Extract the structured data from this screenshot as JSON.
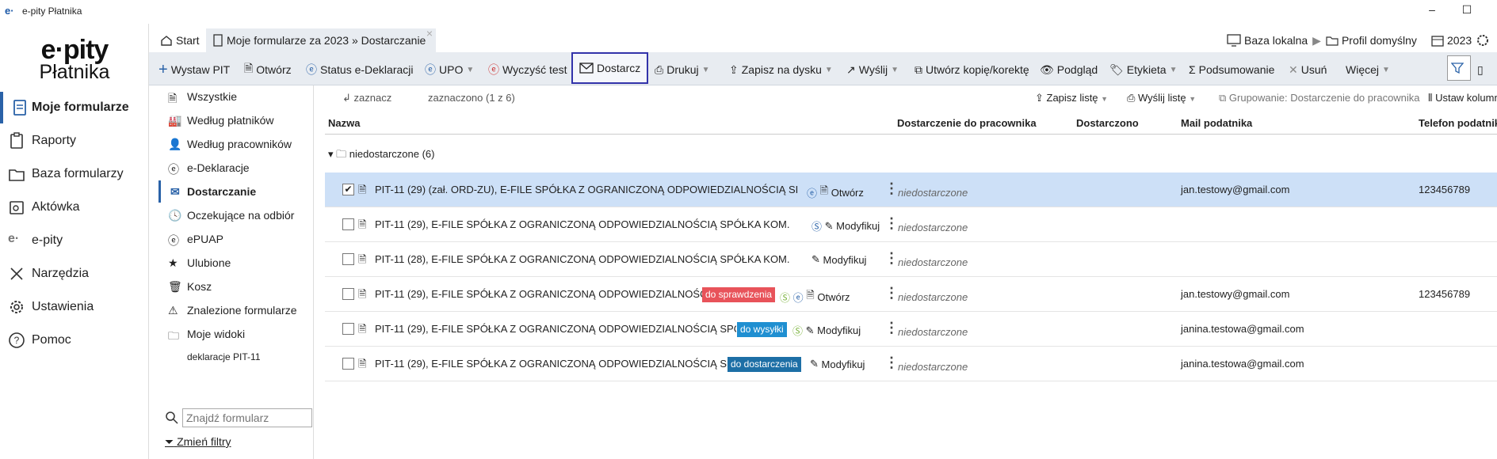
{
  "window": {
    "app_title": "e-pity Płatnika",
    "minimize": "–",
    "maximize": "☐"
  },
  "brand": {
    "logo": "e·pity",
    "subtitle": "Płatnika"
  },
  "nav": {
    "items": [
      {
        "label": "Moje formularze",
        "icon": "document-icon",
        "active": true
      },
      {
        "label": "Raporty",
        "icon": "clipboard-icon"
      },
      {
        "label": "Baza formularzy",
        "icon": "folder-icon"
      },
      {
        "label": "Aktówka",
        "icon": "briefcase-icon"
      },
      {
        "label": "e-pity",
        "icon": "epity-icon"
      },
      {
        "label": "Narzędzia",
        "icon": "tools-icon"
      },
      {
        "label": "Ustawienia",
        "icon": "gear-icon"
      },
      {
        "label": "Pomoc",
        "icon": "help-icon"
      }
    ]
  },
  "tabs": {
    "start": "Start",
    "forms": "Moje formularze za 2023 » Dostarczanie",
    "close": "×"
  },
  "header": {
    "db": "Baza lokalna",
    "profile": "Profil domyślny",
    "year": "2023"
  },
  "toolbar": {
    "wystaw": "Wystaw PIT",
    "otworz": "Otwórz",
    "status": "Status e-Deklaracji",
    "upo": "UPO",
    "wyczysc": "Wyczyść test",
    "dostarcz": "Dostarcz",
    "drukuj": "Drukuj",
    "zapisz": "Zapisz na dysku",
    "wyslij": "Wyślij",
    "kopia": "Utwórz kopię/korektę",
    "podglad": "Podgląd",
    "etykieta": "Etykieta",
    "podsumowanie": "Podsumowanie",
    "usun": "Usuń",
    "wiecej": "Więcej"
  },
  "sidepanel": {
    "items": [
      "Wszystkie",
      "Według płatników",
      "Według pracowników",
      "e-Deklaracje",
      "Dostarczanie",
      "Oczekujące na odbiór",
      "ePUAP",
      "Ulubione",
      "Kosz",
      "Znalezione formularze",
      "Moje widoki"
    ],
    "sub": "deklaracje PIT-11",
    "search_placeholder": "Znajdź formularz",
    "filter_link": "Zmień filtry"
  },
  "subbar": {
    "zaznacz": "zaznacz",
    "zaznaczono": "zaznaczono (1 z 6)",
    "zapisz_liste": "Zapisz listę",
    "wyslij_liste": "Wyślij listę",
    "grupowanie": "Grupowanie: Dostarczenie do pracownika",
    "ustaw": "Ustaw kolumny"
  },
  "columns": {
    "nazwa": "Nazwa",
    "dostarczenie": "Dostarczenie do pracownika",
    "dostarczono": "Dostarczono",
    "mail": "Mail podatnika",
    "telefon": "Telefon podatnika"
  },
  "group": {
    "label": "niedostarczone (6)"
  },
  "rows": [
    {
      "name": "PIT-11 (29) (zał. ORD-ZU), E-FILE SPÓŁKA Z OGRANICZONĄ ODPOWIEDZIALNOŚCIĄ SI",
      "status": "niedostarczone",
      "mail": "jan.testowy@gmail.com",
      "tel": "123456789",
      "action": "Otwórz",
      "badge": "",
      "checked": "✔"
    },
    {
      "name": "PIT-11 (29), E-FILE SPÓŁKA Z OGRANICZONĄ ODPOWIEDZIALNOŚCIĄ SPÓŁKA KOM.",
      "status": "niedostarczone",
      "mail": "",
      "tel": "",
      "action": "Modyfikuj",
      "badge": "",
      "checked": ""
    },
    {
      "name": "PIT-11 (28), E-FILE SPÓŁKA Z OGRANICZONĄ ODPOWIEDZIALNOŚCIĄ SPÓŁKA KOM.",
      "status": "niedostarczone",
      "mail": "",
      "tel": "",
      "action": "Modyfikuj",
      "badge": "",
      "checked": ""
    },
    {
      "name": "PIT-11 (29), E-FILE SPÓŁKA Z OGRANICZONĄ ODPOWIEDZIALNOŚĆ",
      "status": "niedostarczone",
      "mail": "jan.testowy@gmail.com",
      "tel": "123456789",
      "action": "Otwórz",
      "badge": "do sprawdzenia",
      "checked": ""
    },
    {
      "name": "PIT-11 (29), E-FILE SPÓŁKA Z OGRANICZONĄ ODPOWIEDZIALNOŚCIĄ SPÓ",
      "status": "niedostarczone",
      "mail": "janina.testowa@gmail.com",
      "tel": "",
      "action": "Modyfikuj",
      "badge": "do wysyłki",
      "checked": ""
    },
    {
      "name": "PIT-11 (29), E-FILE SPÓŁKA Z OGRANICZONĄ ODPOWIEDZIALNOŚCIĄ S",
      "status": "niedostarczone",
      "mail": "janina.testowa@gmail.com",
      "tel": "",
      "action": "Modyfikuj",
      "badge": "do dostarczenia",
      "checked": ""
    }
  ],
  "colors": {
    "accent": "#2a62a8",
    "toolbar_bg": "#e8ecf1",
    "selected_row": "#cde0f7",
    "badge_red": "#e8535a",
    "badge_blue": "#1f8fd1",
    "badge_darkblue": "#1d6fa6"
  }
}
